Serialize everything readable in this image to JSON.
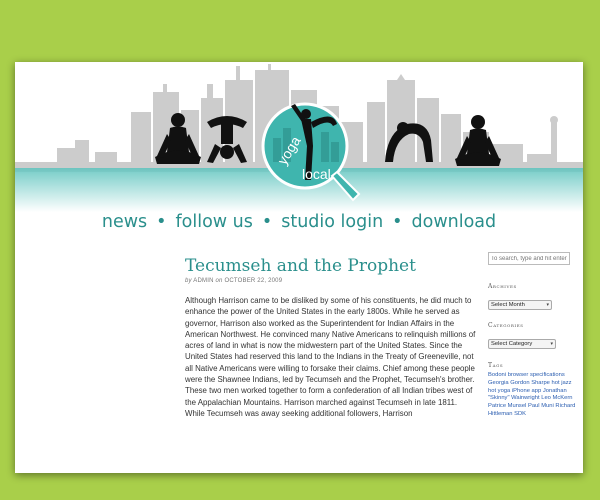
{
  "nav": {
    "items": [
      "news",
      "follow us",
      "studio login",
      "download"
    ],
    "separator": "•"
  },
  "logo": {
    "word1": "yoga",
    "word2": "local"
  },
  "post": {
    "title": "Tecumseh and the Prophet",
    "by": "by",
    "author": "ADMIN",
    "on": "on",
    "date": "OCTOBER 22, 2009",
    "body": "Although Harrison came to be disliked by some of his constituents, he did much to enhance the power of the United States in the early 1800s. While he served as governor, Harrison also worked as the Superintendent for Indian Affairs in the American Northwest. He convinced many Native Americans to relinquish millions of acres of land in what is now the midwestern part of the United States. Since the United States had reserved this land to the Indians in the Treaty of Greeneville, not all Native Americans were willing to forsake their claims. Chief among these people were the Shawnee Indians, led by Tecumseh and the Prophet, Tecumseh's brother. These two men worked together to form a confederation of all Indian tribes west of the Appalachian Mountains. Harrison marched against Tecumseh in late 1811. While Tecumseh was away seeking additional followers, Harrison"
  },
  "sidebar": {
    "search_placeholder": "To search, type and hit enter",
    "archives_title": "Archives",
    "archives_select": "Select Month",
    "categories_title": "Categories",
    "categories_select": "Select Category",
    "tags_title": "Tags",
    "tags": [
      "Bodoni",
      "browser",
      "specifications",
      "Georgia",
      "Gordon",
      "Sharpe",
      "hot jazz",
      "hot yoga",
      "iPhone app",
      "Jonathan",
      "\"Skinny\" Wainwright",
      "Leo",
      "McKern",
      "Patrice Munsel",
      "Paul",
      "Muni",
      "Richard Hittleman",
      "SDK"
    ]
  },
  "colors": {
    "background": "#a9cf4a",
    "accent": "#2a8f8c",
    "teal_circle": "#3fb5ae",
    "link": "#2a5db0"
  }
}
